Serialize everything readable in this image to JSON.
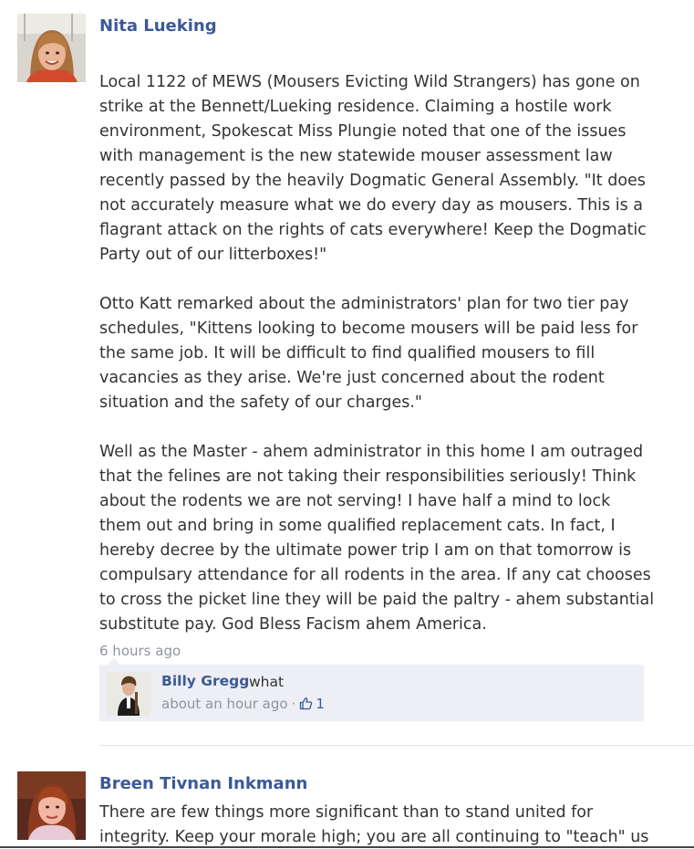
{
  "posts": [
    {
      "author": "Nita Lueking",
      "paragraphs": [
        "Local 1122 of MEWS (Mousers Evicting Wild Strangers) has gone on strike at the Bennett/Lueking residence. Claiming a hostile work environment, Spokescat Miss Plungie noted that one of the issues with management is the new statewide mouser assessment law recently passed by the heavily Dogmatic General Assembly. \"It does not accurately measure what we do every day as mousers. This is a flagrant attack on the rights of cats everywhere! Keep the Dogmatic Party out of our litterboxes!\"",
        "Otto Katt remarked about the administrators' plan for two tier pay schedules, \"Kittens looking to become mousers will be paid less for the same job. It will be difficult to find qualified mousers to fill vacancies as they arise. We're just concerned about the rodent situation and the safety of our charges.\"",
        "Well as the Master - ahem administrator in this home I am outraged that the felines are not taking their responsibilities seriously! Think about the rodents we are not serving! I have half a mind to lock them out and bring in some qualified replacement cats. In fact, I hereby decree by the ultimate power trip I am on that tomorrow is compulsary attendance for all rodents in the area. If any cat chooses to cross the picket line they will be paid the paltry - ahem substantial substitute pay. God Bless Facism ahem America."
      ],
      "timestamp": "6 hours ago",
      "comments": [
        {
          "author": "Billy Gregg",
          "text": "what",
          "timestamp": "about an hour ago",
          "separator": "·",
          "likes": "1"
        }
      ]
    },
    {
      "author": "Breen Tivnan Inkmann",
      "text": "There are few things more significant than to stand united for integrity. Keep your morale high; you are all continuing to \"teach\" us"
    }
  ],
  "icons": {
    "like": "thumbs-up-icon"
  },
  "colors": {
    "link": "#3b5998",
    "text": "#333333",
    "meta": "#90949c",
    "comment_bg": "#edeff4"
  }
}
